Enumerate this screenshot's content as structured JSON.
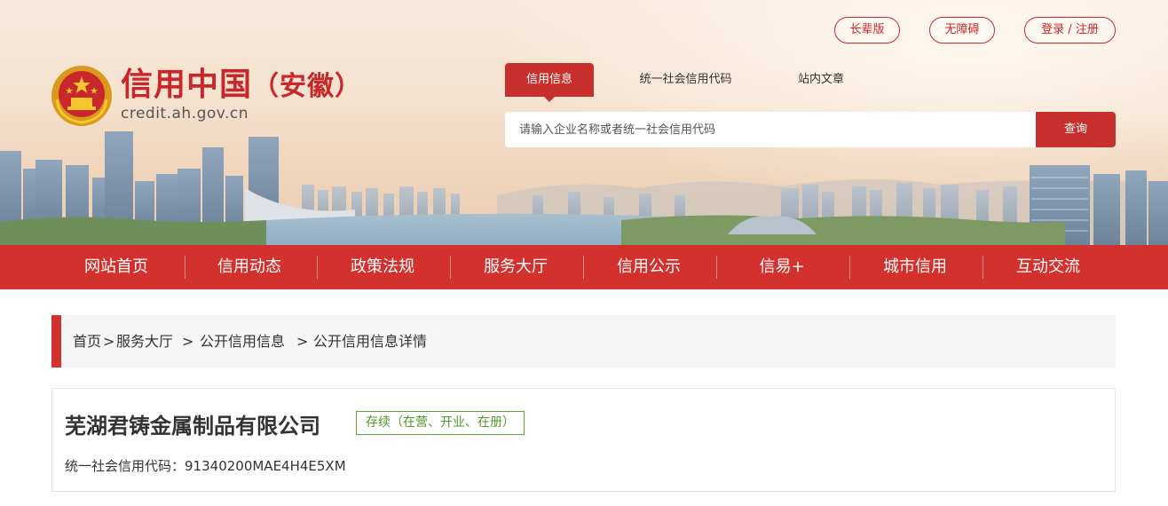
{
  "header": {
    "site_name_main": "信用中国",
    "site_name_region": "（安徽）",
    "site_domain": "credit.ah.gov.cn",
    "top_links": {
      "elder": "长辈版",
      "accessibility": "无障碍",
      "login": "登录 / 注册"
    }
  },
  "search": {
    "tabs": [
      "信用信息",
      "统一社会信用代码",
      "站内文章"
    ],
    "active_tab": "信用信息",
    "placeholder": "请输入企业名称或者统一社会信用代码",
    "button_label": "查询"
  },
  "nav": {
    "items": [
      "网站首页",
      "信用动态",
      "政策法规",
      "服务大厅",
      "信用公示",
      "信易+",
      "城市信用",
      "互动交流"
    ]
  },
  "breadcrumb": {
    "items": [
      "首页",
      "服务大厅",
      "公开信用信息",
      "公开信用信息详情"
    ],
    "separator": ">"
  },
  "company": {
    "name": "芜湖君铸金属制品有限公司",
    "status": "存续（在营、开业、在册）",
    "code_label": "统一社会信用代码：",
    "code_value": "91340200MAE4H4E5XM"
  },
  "colors": {
    "brand_red": "#d3312e",
    "status_green": "#5fa53a"
  }
}
